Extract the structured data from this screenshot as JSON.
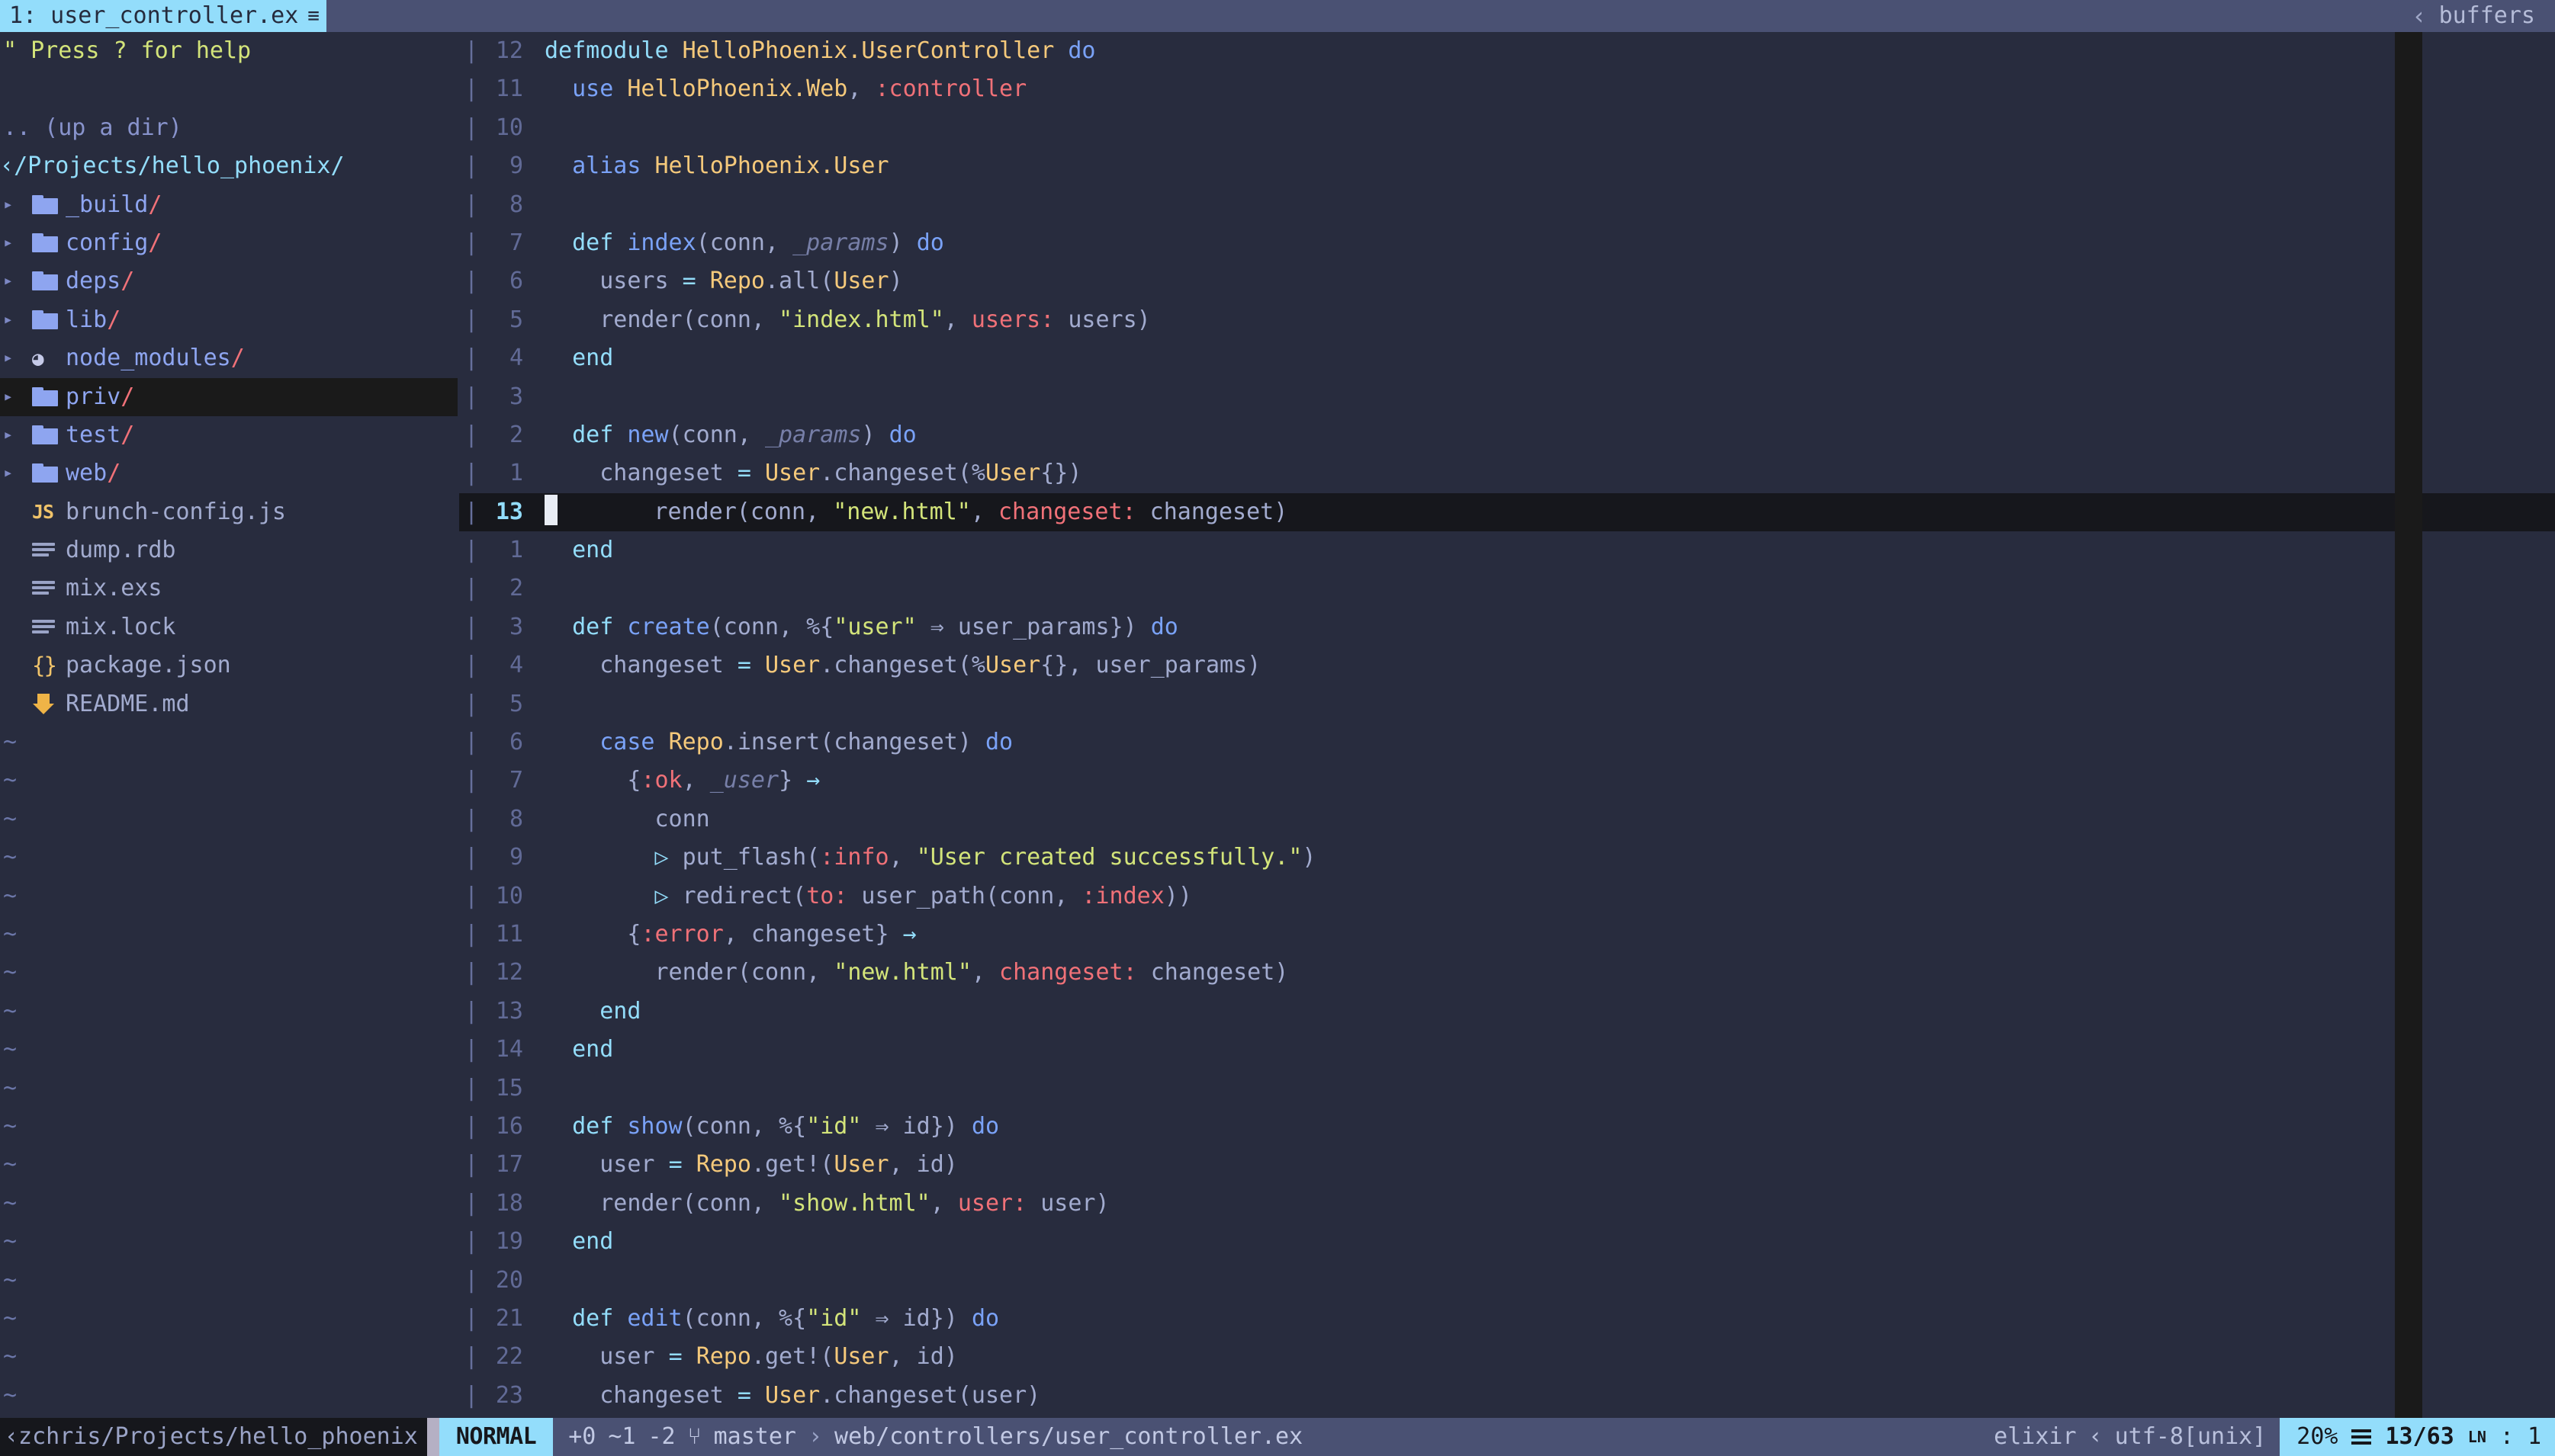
{
  "tabline": {
    "active_tab": "1: user_controller.ex",
    "active_tab_icon": "lines-icon",
    "right_chevron": "‹",
    "right_label": "buffers"
  },
  "explorer": {
    "help_hint": "\" Press ? for help",
    "up_dir": ".. (up a dir)",
    "root_chevron": "‹",
    "root_path": "/Projects/hello_phoenix/",
    "items": [
      {
        "arrow": "▸",
        "icon": "folder-icon",
        "name": "_build",
        "slash": "/",
        "kind": "dir",
        "cursor": false
      },
      {
        "arrow": "▸",
        "icon": "folder-icon",
        "name": "config",
        "slash": "/",
        "kind": "dir",
        "cursor": false
      },
      {
        "arrow": "▸",
        "icon": "folder-icon",
        "name": "deps",
        "slash": "/",
        "kind": "dir",
        "cursor": false
      },
      {
        "arrow": "▸",
        "icon": "folder-icon",
        "name": "lib",
        "slash": "/",
        "kind": "dir",
        "cursor": false
      },
      {
        "arrow": "▸",
        "icon": "nodejs-icon",
        "name": "node_modules",
        "slash": "/",
        "kind": "dir",
        "cursor": false
      },
      {
        "arrow": "▸",
        "icon": "folder-icon",
        "name": "priv",
        "slash": "/",
        "kind": "dir",
        "cursor": true
      },
      {
        "arrow": "▸",
        "icon": "folder-icon",
        "name": "test",
        "slash": "/",
        "kind": "dir",
        "cursor": false
      },
      {
        "arrow": "▸",
        "icon": "folder-icon",
        "name": "web",
        "slash": "/",
        "kind": "dir",
        "cursor": false
      },
      {
        "arrow": "",
        "icon": "javascript-icon",
        "name": "brunch-config.js",
        "slash": "",
        "kind": "file",
        "cursor": false
      },
      {
        "arrow": "",
        "icon": "lines-file-icon",
        "name": "dump.rdb",
        "slash": "",
        "kind": "file",
        "cursor": false
      },
      {
        "arrow": "",
        "icon": "lines-file-icon",
        "name": "mix.exs",
        "slash": "",
        "kind": "file",
        "cursor": false
      },
      {
        "arrow": "",
        "icon": "lines-file-icon",
        "name": "mix.lock",
        "slash": "",
        "kind": "file",
        "cursor": false
      },
      {
        "arrow": "",
        "icon": "json-braces-icon",
        "name": "package.json",
        "slash": "",
        "kind": "file",
        "cursor": false
      },
      {
        "arrow": "",
        "icon": "markdown-arrow-icon",
        "name": "README.md",
        "slash": "",
        "kind": "file",
        "cursor": false
      }
    ],
    "empty_marker": "~",
    "empty_marker_count": 19
  },
  "editor": {
    "fold_marker": "|",
    "cursor_line_number": "13",
    "lines": [
      {
        "num": "12",
        "cursor": false,
        "tokens": [
          {
            "t": "defmodule",
            "c": "kw2"
          },
          {
            "t": " ",
            "c": "pl"
          },
          {
            "t": "HelloPhoenix.UserController",
            "c": "mod"
          },
          {
            "t": " ",
            "c": "pl"
          },
          {
            "t": "do",
            "c": "kw"
          }
        ]
      },
      {
        "num": "11",
        "cursor": false,
        "tokens": [
          {
            "t": "  ",
            "c": "pl"
          },
          {
            "t": "use",
            "c": "kw"
          },
          {
            "t": " ",
            "c": "pl"
          },
          {
            "t": "HelloPhoenix.Web",
            "c": "mod"
          },
          {
            "t": ", ",
            "c": "pl"
          },
          {
            "t": ":controller",
            "c": "atom"
          }
        ]
      },
      {
        "num": "10",
        "cursor": false,
        "tokens": []
      },
      {
        "num": "9",
        "cursor": false,
        "tokens": [
          {
            "t": "  ",
            "c": "pl"
          },
          {
            "t": "alias",
            "c": "kw"
          },
          {
            "t": " ",
            "c": "pl"
          },
          {
            "t": "HelloPhoenix.User",
            "c": "mod"
          }
        ]
      },
      {
        "num": "8",
        "cursor": false,
        "tokens": []
      },
      {
        "num": "7",
        "cursor": false,
        "tokens": [
          {
            "t": "  ",
            "c": "pl"
          },
          {
            "t": "def",
            "c": "kw2"
          },
          {
            "t": " ",
            "c": "pl"
          },
          {
            "t": "index",
            "c": "fn"
          },
          {
            "t": "(conn, ",
            "c": "pl"
          },
          {
            "t": "_params",
            "c": "arg"
          },
          {
            "t": ") ",
            "c": "pl"
          },
          {
            "t": "do",
            "c": "kw"
          }
        ]
      },
      {
        "num": "6",
        "cursor": false,
        "tokens": [
          {
            "t": "    users ",
            "c": "pl"
          },
          {
            "t": "=",
            "c": "op"
          },
          {
            "t": " ",
            "c": "pl"
          },
          {
            "t": "Repo",
            "c": "mod"
          },
          {
            "t": ".all(",
            "c": "pl"
          },
          {
            "t": "User",
            "c": "mod"
          },
          {
            "t": ")",
            "c": "pl"
          }
        ]
      },
      {
        "num": "5",
        "cursor": false,
        "tokens": [
          {
            "t": "    render(conn, ",
            "c": "pl"
          },
          {
            "t": "\"index.html\"",
            "c": "str"
          },
          {
            "t": ", ",
            "c": "pl"
          },
          {
            "t": "users:",
            "c": "atom"
          },
          {
            "t": " users)",
            "c": "pl"
          }
        ]
      },
      {
        "num": "4",
        "cursor": false,
        "tokens": [
          {
            "t": "  ",
            "c": "pl"
          },
          {
            "t": "end",
            "c": "kw2"
          }
        ]
      },
      {
        "num": "3",
        "cursor": false,
        "tokens": []
      },
      {
        "num": "2",
        "cursor": false,
        "tokens": [
          {
            "t": "  ",
            "c": "pl"
          },
          {
            "t": "def",
            "c": "kw2"
          },
          {
            "t": " ",
            "c": "pl"
          },
          {
            "t": "new",
            "c": "fn"
          },
          {
            "t": "(conn, ",
            "c": "pl"
          },
          {
            "t": "_params",
            "c": "arg"
          },
          {
            "t": ") ",
            "c": "pl"
          },
          {
            "t": "do",
            "c": "kw"
          }
        ]
      },
      {
        "num": "1",
        "cursor": false,
        "tokens": [
          {
            "t": "    changeset ",
            "c": "pl"
          },
          {
            "t": "=",
            "c": "op"
          },
          {
            "t": " ",
            "c": "pl"
          },
          {
            "t": "User",
            "c": "mod"
          },
          {
            "t": ".changeset(%",
            "c": "pl"
          },
          {
            "t": "User",
            "c": "mod"
          },
          {
            "t": "{})",
            "c": "pl"
          }
        ]
      },
      {
        "num": "13",
        "cursor": true,
        "tokens": [
          {
            "t": "    render(conn, ",
            "c": "pl"
          },
          {
            "t": "\"new.html\"",
            "c": "str"
          },
          {
            "t": ", ",
            "c": "pl"
          },
          {
            "t": "changeset:",
            "c": "atom"
          },
          {
            "t": " changeset)",
            "c": "pl"
          }
        ]
      },
      {
        "num": "1",
        "cursor": false,
        "tokens": [
          {
            "t": "  ",
            "c": "pl"
          },
          {
            "t": "end",
            "c": "kw2"
          }
        ]
      },
      {
        "num": "2",
        "cursor": false,
        "tokens": []
      },
      {
        "num": "3",
        "cursor": false,
        "tokens": [
          {
            "t": "  ",
            "c": "pl"
          },
          {
            "t": "def",
            "c": "kw2"
          },
          {
            "t": " ",
            "c": "pl"
          },
          {
            "t": "create",
            "c": "fn"
          },
          {
            "t": "(conn, %{",
            "c": "pl"
          },
          {
            "t": "\"user\"",
            "c": "str"
          },
          {
            "t": " ⇒ user_params}) ",
            "c": "pl"
          },
          {
            "t": "do",
            "c": "kw"
          }
        ]
      },
      {
        "num": "4",
        "cursor": false,
        "tokens": [
          {
            "t": "    changeset ",
            "c": "pl"
          },
          {
            "t": "=",
            "c": "op"
          },
          {
            "t": " ",
            "c": "pl"
          },
          {
            "t": "User",
            "c": "mod"
          },
          {
            "t": ".changeset(%",
            "c": "pl"
          },
          {
            "t": "User",
            "c": "mod"
          },
          {
            "t": "{}, user_params)",
            "c": "pl"
          }
        ]
      },
      {
        "num": "5",
        "cursor": false,
        "tokens": []
      },
      {
        "num": "6",
        "cursor": false,
        "tokens": [
          {
            "t": "    ",
            "c": "pl"
          },
          {
            "t": "case",
            "c": "kw"
          },
          {
            "t": " ",
            "c": "pl"
          },
          {
            "t": "Repo",
            "c": "mod"
          },
          {
            "t": ".insert(changeset) ",
            "c": "pl"
          },
          {
            "t": "do",
            "c": "kw"
          }
        ]
      },
      {
        "num": "7",
        "cursor": false,
        "tokens": [
          {
            "t": "      {",
            "c": "pl"
          },
          {
            "t": ":ok",
            "c": "atom"
          },
          {
            "t": ", ",
            "c": "pl"
          },
          {
            "t": "_user",
            "c": "arg"
          },
          {
            "t": "} ",
            "c": "pl"
          },
          {
            "t": "→",
            "c": "op"
          }
        ]
      },
      {
        "num": "8",
        "cursor": false,
        "tokens": [
          {
            "t": "        conn",
            "c": "pl"
          }
        ]
      },
      {
        "num": "9",
        "cursor": false,
        "tokens": [
          {
            "t": "        ",
            "c": "pl"
          },
          {
            "t": "▷",
            "c": "op"
          },
          {
            "t": " put_flash(",
            "c": "pl"
          },
          {
            "t": ":info",
            "c": "atom"
          },
          {
            "t": ", ",
            "c": "pl"
          },
          {
            "t": "\"User created successfully.\"",
            "c": "str"
          },
          {
            "t": ")",
            "c": "pl"
          }
        ]
      },
      {
        "num": "10",
        "cursor": false,
        "tokens": [
          {
            "t": "        ",
            "c": "pl"
          },
          {
            "t": "▷",
            "c": "op"
          },
          {
            "t": " redirect(",
            "c": "pl"
          },
          {
            "t": "to:",
            "c": "atom"
          },
          {
            "t": " user_path(conn, ",
            "c": "pl"
          },
          {
            "t": ":index",
            "c": "atom"
          },
          {
            "t": "))",
            "c": "pl"
          }
        ]
      },
      {
        "num": "11",
        "cursor": false,
        "tokens": [
          {
            "t": "      {",
            "c": "pl"
          },
          {
            "t": ":error",
            "c": "atom"
          },
          {
            "t": ", changeset} ",
            "c": "pl"
          },
          {
            "t": "→",
            "c": "op"
          }
        ]
      },
      {
        "num": "12",
        "cursor": false,
        "tokens": [
          {
            "t": "        render(conn, ",
            "c": "pl"
          },
          {
            "t": "\"new.html\"",
            "c": "str"
          },
          {
            "t": ", ",
            "c": "pl"
          },
          {
            "t": "changeset:",
            "c": "atom"
          },
          {
            "t": " changeset)",
            "c": "pl"
          }
        ]
      },
      {
        "num": "13",
        "cursor": false,
        "tokens": [
          {
            "t": "    ",
            "c": "pl"
          },
          {
            "t": "end",
            "c": "kw2"
          }
        ]
      },
      {
        "num": "14",
        "cursor": false,
        "tokens": [
          {
            "t": "  ",
            "c": "pl"
          },
          {
            "t": "end",
            "c": "kw2"
          }
        ]
      },
      {
        "num": "15",
        "cursor": false,
        "tokens": []
      },
      {
        "num": "16",
        "cursor": false,
        "tokens": [
          {
            "t": "  ",
            "c": "pl"
          },
          {
            "t": "def",
            "c": "kw2"
          },
          {
            "t": " ",
            "c": "pl"
          },
          {
            "t": "show",
            "c": "fn"
          },
          {
            "t": "(conn, %{",
            "c": "pl"
          },
          {
            "t": "\"id\"",
            "c": "str"
          },
          {
            "t": " ⇒ id}) ",
            "c": "pl"
          },
          {
            "t": "do",
            "c": "kw"
          }
        ]
      },
      {
        "num": "17",
        "cursor": false,
        "tokens": [
          {
            "t": "    user ",
            "c": "pl"
          },
          {
            "t": "=",
            "c": "op"
          },
          {
            "t": " ",
            "c": "pl"
          },
          {
            "t": "Repo",
            "c": "mod"
          },
          {
            "t": ".get!(",
            "c": "pl"
          },
          {
            "t": "User",
            "c": "mod"
          },
          {
            "t": ", id)",
            "c": "pl"
          }
        ]
      },
      {
        "num": "18",
        "cursor": false,
        "tokens": [
          {
            "t": "    render(conn, ",
            "c": "pl"
          },
          {
            "t": "\"show.html\"",
            "c": "str"
          },
          {
            "t": ", ",
            "c": "pl"
          },
          {
            "t": "user:",
            "c": "atom"
          },
          {
            "t": " user)",
            "c": "pl"
          }
        ]
      },
      {
        "num": "19",
        "cursor": false,
        "tokens": [
          {
            "t": "  ",
            "c": "pl"
          },
          {
            "t": "end",
            "c": "kw2"
          }
        ]
      },
      {
        "num": "20",
        "cursor": false,
        "tokens": []
      },
      {
        "num": "21",
        "cursor": false,
        "tokens": [
          {
            "t": "  ",
            "c": "pl"
          },
          {
            "t": "def",
            "c": "kw2"
          },
          {
            "t": " ",
            "c": "pl"
          },
          {
            "t": "edit",
            "c": "fn"
          },
          {
            "t": "(conn, %{",
            "c": "pl"
          },
          {
            "t": "\"id\"",
            "c": "str"
          },
          {
            "t": " ⇒ id}) ",
            "c": "pl"
          },
          {
            "t": "do",
            "c": "kw"
          }
        ]
      },
      {
        "num": "22",
        "cursor": false,
        "tokens": [
          {
            "t": "    user ",
            "c": "pl"
          },
          {
            "t": "=",
            "c": "op"
          },
          {
            "t": " ",
            "c": "pl"
          },
          {
            "t": "Repo",
            "c": "mod"
          },
          {
            "t": ".get!(",
            "c": "pl"
          },
          {
            "t": "User",
            "c": "mod"
          },
          {
            "t": ", id)",
            "c": "pl"
          }
        ]
      },
      {
        "num": "23",
        "cursor": false,
        "tokens": [
          {
            "t": "    changeset ",
            "c": "pl"
          },
          {
            "t": "=",
            "c": "op"
          },
          {
            "t": " ",
            "c": "pl"
          },
          {
            "t": "User",
            "c": "mod"
          },
          {
            "t": ".changeset(user)",
            "c": "pl"
          }
        ]
      }
    ]
  },
  "statusline": {
    "path": "‹zchris/Projects/hello_phoenix",
    "mode": "NORMAL",
    "git_added": "+0",
    "git_modified": "~1",
    "git_removed": "-2",
    "branch_icon": "git-branch-icon",
    "branch": "master",
    "breadcrumb_chevron": "›",
    "file_path": "web/controllers/user_controller.ex",
    "filetype": "elixir",
    "filetype_chevron": "‹",
    "encoding": "utf-8[unix]",
    "percent": "20%",
    "lines_icon": "lines-icon",
    "position": "13/63",
    "ln_glyph": "LN",
    "colon": ":",
    "column": "1"
  },
  "colors": {
    "bg": "#282c3e",
    "tabline_bg": "#4a5173",
    "accent": "#93ddfb",
    "cursorline_bg": "#16171c",
    "string": "#d3e47a",
    "atom": "#f07178",
    "module": "#f5c97b",
    "keyword": "#7aa2f7",
    "dir": "#8ea5f0"
  }
}
